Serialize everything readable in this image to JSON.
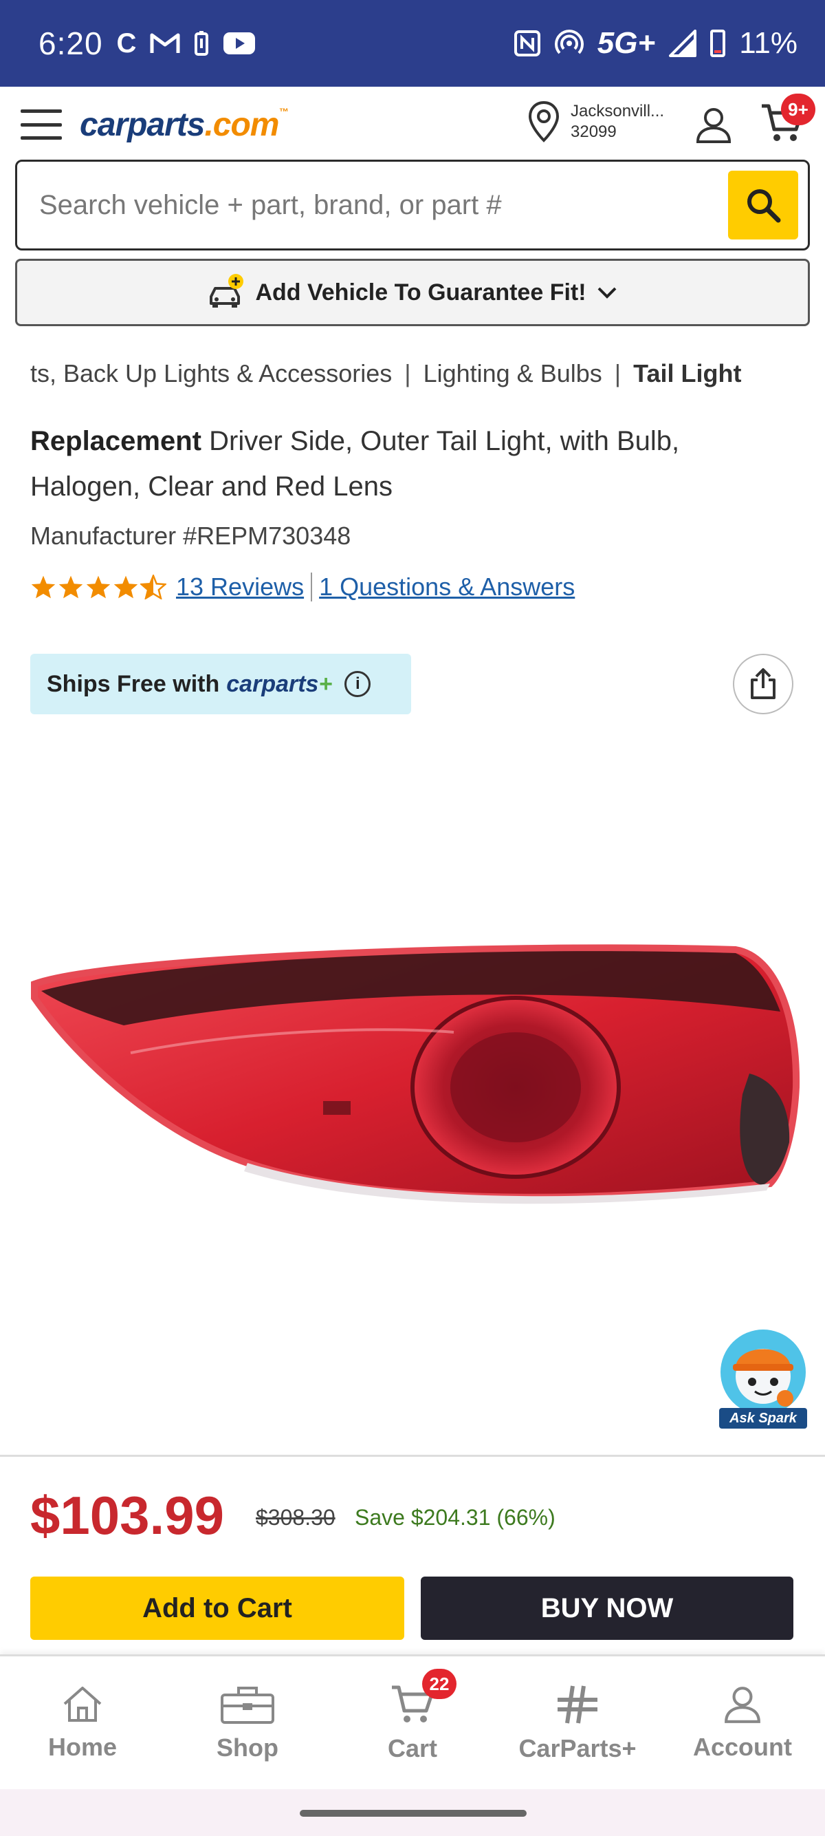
{
  "status_bar": {
    "time": "6:20",
    "network": "5G+",
    "battery": "11%",
    "icons": [
      "c-app-icon",
      "gmail-icon",
      "battery-saver-icon",
      "youtube-icon",
      "nfc-icon",
      "hotspot-icon",
      "signal-icon",
      "battery-icon"
    ]
  },
  "header": {
    "logo_main": "carparts",
    "logo_dot": ".com",
    "logo_tm": "™",
    "location_city": "Jacksonvill...",
    "location_zip": "32099",
    "cart_badge": "9+"
  },
  "search": {
    "placeholder": "Search vehicle + part, brand, or part #"
  },
  "vehicle": {
    "label": "Add Vehicle To Guarantee Fit!"
  },
  "breadcrumb": {
    "items": [
      "ts, Back Up Lights & Accessories",
      "Lighting & Bulbs"
    ],
    "current": "Tail Light",
    "separator": "|"
  },
  "product": {
    "brand": "Replacement",
    "title": "Driver Side, Outer Tail Light, with Bulb, Halogen, Clear and Red Lens",
    "manufacturer": "Manufacturer #REPM730348",
    "rating": 4.5,
    "reviews_link": "13 Reviews",
    "qa_link": "1 Questions & Answers",
    "ships_text": "Ships Free with",
    "ships_brand": "carparts",
    "ships_plus": "+",
    "ships_info": "i"
  },
  "pricing": {
    "price": "$103.99",
    "old_price": "$308.30",
    "save": "Save $204.31 (66%)",
    "add_to_cart": "Add to Cart",
    "buy_now": "BUY NOW"
  },
  "assistant": {
    "label": "Ask Spark"
  },
  "bottom_nav": {
    "items": [
      {
        "label": "Home",
        "icon": "home-icon"
      },
      {
        "label": "Shop",
        "icon": "toolbox-icon"
      },
      {
        "label": "Cart",
        "icon": "cart-icon"
      },
      {
        "label": "CarParts+",
        "icon": "carparts-plus-icon"
      },
      {
        "label": "Account",
        "icon": "account-icon"
      }
    ],
    "cart_badge": "22"
  },
  "colors": {
    "status_bar": "#2c3e8c",
    "brand_blue": "#1a3d7a",
    "brand_orange": "#f28c00",
    "accent_yellow": "#ffcc00",
    "price_red": "#c8282e",
    "save_green": "#3d7a1f",
    "link_blue": "#1e5fa8"
  }
}
